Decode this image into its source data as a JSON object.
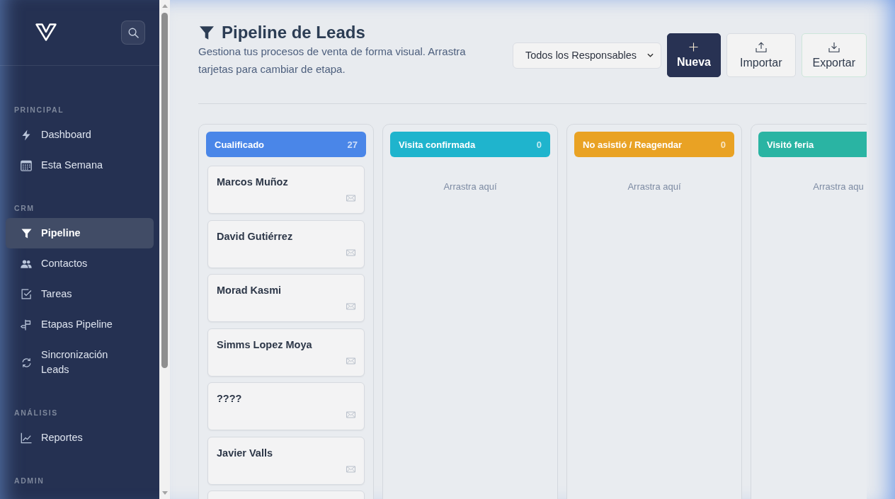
{
  "sidebar": {
    "sections": [
      {
        "title": "PRINCIPAL",
        "items": [
          {
            "label": "Dashboard",
            "selected": false
          },
          {
            "label": "Esta Semana",
            "selected": false
          }
        ]
      },
      {
        "title": "CRM",
        "items": [
          {
            "label": "Pipeline",
            "selected": true
          },
          {
            "label": "Contactos",
            "selected": false
          },
          {
            "label": "Tareas",
            "selected": false
          },
          {
            "label": "Etapas Pipeline",
            "selected": false
          },
          {
            "label": "Sincronización Leads",
            "selected": false
          }
        ]
      },
      {
        "title": "ANÁLISIS",
        "items": [
          {
            "label": "Reportes",
            "selected": false
          }
        ]
      },
      {
        "title": "ADMIN"
      }
    ]
  },
  "page_header": {
    "title": "Pipeline de Leads",
    "subtitle": "Gestiona tus procesos de venta de forma visual. Arrastra tarjetas para cambiar de etapa.",
    "owner_filter": {
      "value": "Todos los Responsables"
    },
    "actions": [
      {
        "label": "Nueva",
        "kind": "new"
      },
      {
        "label": "Importar",
        "kind": "import"
      },
      {
        "label": "Exportar",
        "kind": "export"
      }
    ]
  },
  "board": {
    "columns": [
      {
        "title": "Cualificado",
        "count": "27",
        "color": "#4a86e8",
        "cards": [
          {
            "name": "Marcos Muñoz"
          },
          {
            "name": "David Gutiérrez"
          },
          {
            "name": "Morad Kasmi"
          },
          {
            "name": "Simms Lopez Moya"
          },
          {
            "name": "????"
          },
          {
            "name": "Javier Valls"
          }
        ],
        "more_cards_below": true
      },
      {
        "title": "Visita confirmada",
        "count": "0",
        "color": "#1fb4cd",
        "empty_hint": "Arrastra aquí"
      },
      {
        "title": "No asistió / Reagendar",
        "count": "0",
        "color": "#e9a224",
        "empty_hint": "Arrastra aquí"
      },
      {
        "title": "Visitó feria",
        "color": "#2ab4a3",
        "empty_hint": "Arrastra aqu"
      }
    ]
  }
}
